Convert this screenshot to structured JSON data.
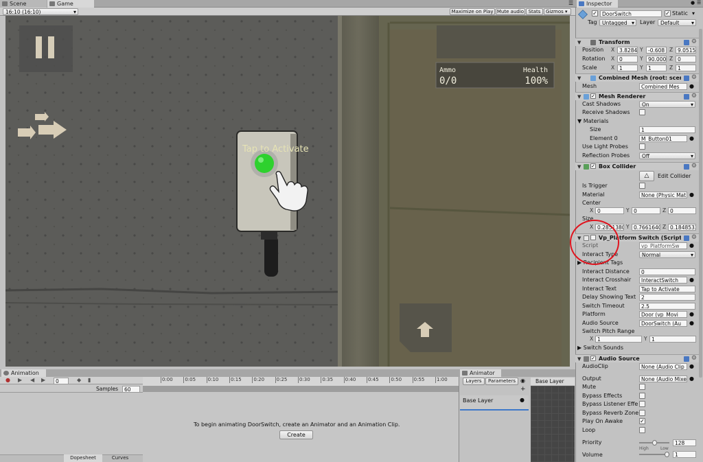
{
  "scene_tab": "Scene",
  "game_tab": "Game",
  "aspect": "16:10 (16:10)",
  "game_toolbar": {
    "maximize": "Maximize on Play",
    "mute": "Mute audio",
    "stats": "Stats",
    "gizmos": "Gizmos"
  },
  "hud": {
    "ammo_label": "Ammo",
    "ammo_value": "0/0",
    "health_label": "Health",
    "health_value": "100%",
    "prompt": "Tap to Activate"
  },
  "inspector": {
    "tab": "Inspector",
    "object_name": "DoorSwitch",
    "static_label": "Static",
    "tag_label": "Tag",
    "tag_value": "Untagged",
    "layer_label": "Layer",
    "layer_value": "Default",
    "transform": {
      "title": "Transform",
      "position_label": "Position",
      "position": [
        "3.8284",
        "-0.608",
        "9.0515"
      ],
      "rotation_label": "Rotation",
      "rotation": [
        "0",
        "90.000",
        "0"
      ],
      "scale_label": "Scale",
      "scale": [
        "1",
        "1",
        "1"
      ]
    },
    "combined_mesh": {
      "title": "Combined Mesh (root: scene)",
      "mesh_label": "Mesh",
      "mesh_value": "Combined Mes"
    },
    "mesh_renderer": {
      "title": "Mesh Renderer",
      "cast_shadows_label": "Cast Shadows",
      "cast_shadows_value": "On",
      "receive_shadows_label": "Receive Shadows",
      "materials_label": "Materials",
      "size_label": "Size",
      "size_value": "1",
      "element0_label": "Element 0",
      "element0_value": "M_Button01",
      "use_light_probes_label": "Use Light Probes",
      "reflection_probes_label": "Reflection Probes",
      "reflection_probes_value": "Off"
    },
    "box_collider": {
      "title": "Box Collider",
      "edit_collider": "Edit Collider",
      "is_trigger_label": "Is Trigger",
      "material_label": "Material",
      "material_value": "None (Physic Mat",
      "center_label": "Center",
      "center": [
        "0",
        "0",
        "0"
      ],
      "size_label": "Size",
      "size": [
        "0.2851380",
        "0.7661640",
        "0.1848533"
      ]
    },
    "platform_switch": {
      "title": "Vp_Platform Switch (Script)",
      "script_label": "Script",
      "script_value": "vp_PlatformSw",
      "interact_type_label": "Interact Type",
      "interact_type_value": "Normal",
      "recipient_tags_label": "Recipient Tags",
      "interact_distance_label": "Interact Distance",
      "interact_distance_value": "0",
      "interact_crosshair_label": "Interact Crosshair",
      "interact_crosshair_value": "InteractSwitch",
      "interact_text_label": "Interact Text",
      "interact_text_value": "Tap to Activate",
      "delay_label": "Delay Showing Text",
      "delay_value": "2",
      "switch_timeout_label": "Switch Timeout",
      "switch_timeout_value": "2.5",
      "platform_label": "Platform",
      "platform_value": "Door (vp_Movi",
      "audio_source_label": "Audio Source",
      "audio_source_value": "DoorSwitch (Au",
      "pitch_label": "Switch Pitch Range",
      "pitch": [
        "1",
        "1"
      ],
      "sounds_label": "Switch Sounds"
    },
    "audio_source": {
      "title": "Audio Source",
      "clip_label": "AudioClip",
      "clip_value": "None (Audio Clip",
      "output_label": "Output",
      "output_value": "None (Audio Mixe",
      "mute_label": "Mute",
      "bypass_effects_label": "Bypass Effects",
      "bypass_listener_label": "Bypass Listener Effe",
      "bypass_reverb_label": "Bypass Reverb Zone",
      "play_on_awake_label": "Play On Awake",
      "loop_label": "Loop",
      "priority_label": "Priority",
      "priority_value": "128",
      "priority_fraction": 0.5,
      "high_label": "High",
      "low_label": "Low",
      "volume_label": "Volume",
      "volume_value": "1",
      "volume_fraction": 1.0
    }
  },
  "animation": {
    "tab": "Animation",
    "frame_value": "0",
    "samples_label": "Samples",
    "samples_value": "60",
    "ticks": [
      "0:00",
      "0:05",
      "0:10",
      "0:15",
      "0:20",
      "0:25",
      "0:30",
      "0:35",
      "0:40",
      "0:45",
      "0:50",
      "0:55",
      "1:00"
    ],
    "message": "To begin animating DoorSwitch, create an Animator and an Animation Clip.",
    "create_button": "Create",
    "dopesheet_tab": "Dopesheet",
    "curves_tab": "Curves"
  },
  "animator": {
    "tab": "Animator",
    "layers_tab": "Layers",
    "parameters_tab": "Parameters",
    "base_layer_header": "Base Layer",
    "base_layer_item": "Base Layer"
  },
  "colors": {
    "highlight_circle": "#e0141e",
    "button_green": "#2ed12e",
    "accent_blue": "#4a78c2"
  }
}
